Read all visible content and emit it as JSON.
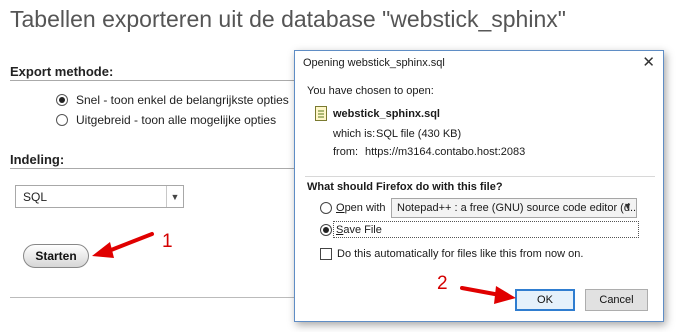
{
  "page": {
    "title": "Tabellen exporteren uit de database \"webstick_sphinx\"",
    "export_method": {
      "heading": "Export methode:",
      "options": [
        {
          "label": "Snel - toon enkel de belangrijkste opties",
          "checked": true
        },
        {
          "label": "Uitgebreid - toon alle mogelijke opties",
          "checked": false
        }
      ]
    },
    "format": {
      "heading": "Indeling:",
      "selected": "SQL"
    },
    "start_button": "Starten"
  },
  "annotations": {
    "step1": "1",
    "step2": "2",
    "arrow_color": "#e00000"
  },
  "dialog": {
    "title": "Opening webstick_sphinx.sql",
    "chosen_text": "You have chosen to open:",
    "file_name": "webstick_sphinx.sql",
    "which_is_label": "which is:",
    "which_is_value": "SQL file (430 KB)",
    "from_label": "from:",
    "from_value": "https://m3164.contabo.host:2083",
    "question": "What should Firefox do with this file?",
    "open_with_label": "Open with",
    "open_with_app": "Notepad++ : a free (GNU) source code editor (d...",
    "save_file_label": "Save File",
    "save_file_selected": true,
    "auto_label": "Do this automatically for files like this from now on.",
    "auto_checked": false,
    "ok_label": "OK",
    "cancel_label": "Cancel"
  }
}
